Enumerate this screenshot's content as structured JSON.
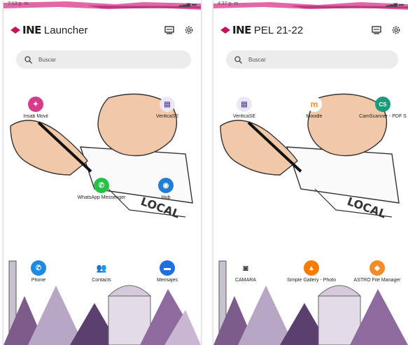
{
  "phone_a": {
    "status": {
      "time": "7:13 p. m."
    },
    "logo_text": "INE",
    "app_title": "Launcher",
    "search_placeholder": "Buscar",
    "apps": [
      {
        "label": "Insab Movil",
        "icon": "insabmovil-icon",
        "color": "#d63b8c"
      },
      {
        "label": "VerificaSE",
        "icon": "verificase-icon",
        "color": "#e9e9f5"
      },
      {
        "label": "WhatsApp Messenger",
        "icon": "whatsapp-icon",
        "color": "#25c247"
      },
      {
        "label": "Hub",
        "icon": "hub-icon",
        "color": "#1f7fd6"
      },
      {
        "label": "Phone",
        "icon": "phone-icon",
        "color": "#1e88e5"
      },
      {
        "label": "Contacts",
        "icon": "contacts-icon",
        "color": "#1e88e5"
      },
      {
        "label": "Mensajes",
        "icon": "messages-icon",
        "color": "#1e6fe0"
      }
    ]
  },
  "phone_b": {
    "status": {
      "time": "4:37 p. m."
    },
    "logo_text": "INE",
    "app_title": "PEL 21-22",
    "search_placeholder": "Buscar",
    "apps": [
      {
        "label": "VerificaSE",
        "icon": "verificase-icon",
        "color": "#e9e9f5"
      },
      {
        "label": "Moodle",
        "icon": "moodle-icon",
        "color": "#ffffff"
      },
      {
        "label": "CamScanner - PDF S",
        "icon": "camscanner-icon",
        "color": "#1a9c7a"
      },
      {
        "label": "CAMARA",
        "icon": "camera-icon",
        "color": "#ffffff"
      },
      {
        "label": "Simple Gallery - Photo",
        "icon": "gallery-icon",
        "color": "#f57c00"
      },
      {
        "label": "ASTRO File Manager",
        "icon": "astro-icon",
        "color": "#f28c28"
      }
    ]
  },
  "colors": {
    "accent": "#c2185b",
    "stripe": "#d9348a"
  }
}
